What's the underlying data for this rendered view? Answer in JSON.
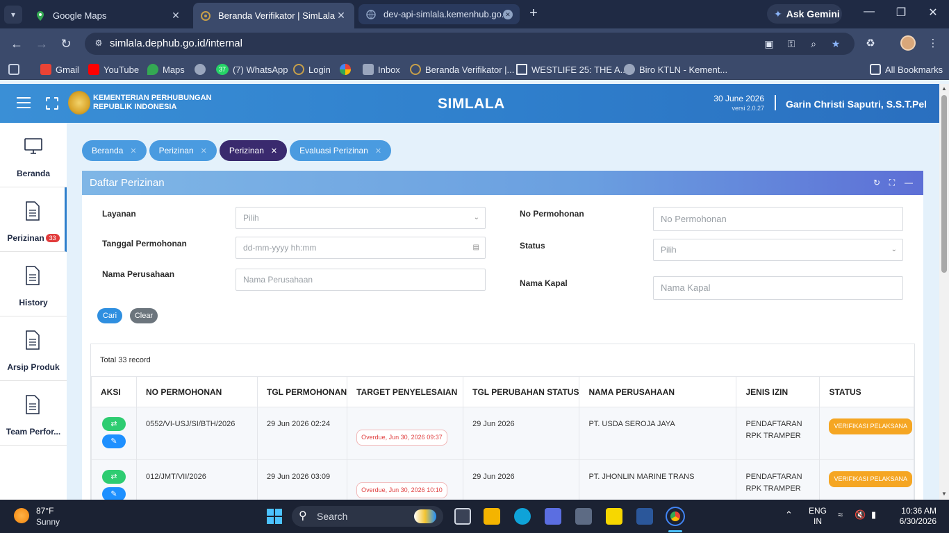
{
  "browser": {
    "tabs": [
      {
        "label": "Google Maps",
        "active": false
      },
      {
        "label": "Beranda Verifikator | SimLala",
        "active": true
      },
      {
        "label": "dev-api-simlala.kemenhub.go.id",
        "active": false
      }
    ],
    "gemini_label": "Ask Gemini",
    "url": "simlala.dephub.go.id/internal",
    "bookmarks": [
      "Gmail",
      "YouTube",
      "Maps",
      "(7) WhatsApp",
      "Login",
      "Inbox",
      "Beranda Verifikator |...",
      "WESTLIFE 25: THE A...",
      "Biro KTLN - Kement..."
    ],
    "whatsapp_badge": "37",
    "all_bookmarks": "All Bookmarks"
  },
  "header": {
    "org_line1": "KEMENTERIAN PERHUBUNGAN",
    "org_line2": "REPUBLIK INDONESIA",
    "app_title": "SIMLALA",
    "date": "30 June 2026",
    "version": "versi 2.0.27",
    "user": "Garin Christi Saputri, S.S.T.Pel"
  },
  "sidebar": {
    "items": [
      {
        "label": "Beranda",
        "icon": "monitor-icon"
      },
      {
        "label": "Perizinan",
        "icon": "document-icon",
        "badge": "33"
      },
      {
        "label": "History",
        "icon": "document-icon"
      },
      {
        "label": "Arsip Produk",
        "icon": "document-icon"
      },
      {
        "label": "Team Perfor...",
        "icon": "document-icon"
      }
    ]
  },
  "breadcrumbs": [
    {
      "label": "Beranda"
    },
    {
      "label": "Perizinan"
    },
    {
      "label": "Perizinan",
      "active": true
    },
    {
      "label": "Evaluasi Perizinan"
    }
  ],
  "panel": {
    "title": "Daftar Perizinan",
    "filters": {
      "layanan_label": "Layanan",
      "layanan_placeholder": "Pilih",
      "tanggal_label": "Tanggal Permohonan",
      "tanggal_placeholder": "dd-mm-yyyy hh:mm",
      "nama_perusahaan_label": "Nama Perusahaan",
      "nama_perusahaan_placeholder": "Nama Perusahaan",
      "no_permohonan_label": "No Permohonan",
      "no_permohonan_placeholder": "No Permohonan",
      "status_label": "Status",
      "status_placeholder": "Pilih",
      "nama_kapal_label": "Nama Kapal",
      "nama_kapal_placeholder": "Nama Kapal"
    },
    "cari_label": "Cari",
    "clear_label": "Clear",
    "total": "Total 33 record",
    "columns": [
      "AKSI",
      "NO PERMOHONAN",
      "TGL PERMOHONAN",
      "TARGET PENYELESAIAN",
      "TGL PERUBAHAN STATUS",
      "NAMA PERUSAHAAN",
      "JENIS IZIN",
      "STATUS"
    ],
    "rows": [
      {
        "no": "0552/VI-USJ/SI/BTH/2026",
        "tgl": "29 Jun 2026 02:24",
        "target": "Overdue, Jun 30, 2026 09:37",
        "tgl_status": "29 Jun 2026",
        "perusahaan": "PT. USDA SEROJA JAYA",
        "jenis": "PENDAFTARAN RPK TRAMPER",
        "status": "VERIFIKASI PELAKSANA"
      },
      {
        "no": "012/JMT/VII/2026",
        "tgl": "29 Jun 2026 03:09",
        "target": "Overdue, Jun 30, 2026 10:10",
        "tgl_status": "29 Jun 2026",
        "perusahaan": "PT. JHONLIN MARINE TRANS",
        "jenis": "PENDAFTARAN RPK TRAMPER",
        "status": "VERIFIKASI PELAKSANA"
      }
    ]
  },
  "taskbar": {
    "temp": "87°F",
    "condition": "Sunny",
    "search_placeholder": "Search",
    "lang1": "ENG",
    "lang2": "IN",
    "time": "10:36 AM",
    "date": "6/30/2026"
  }
}
